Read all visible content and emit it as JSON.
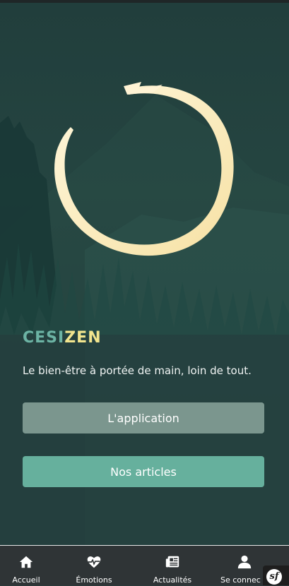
{
  "brand": {
    "part1": "CESI",
    "part2": "ZEN"
  },
  "hero": {
    "tagline": "Le bien-être à portée de main, loin de tout."
  },
  "buttons": {
    "app_label": "L'application",
    "articles_label": "Nos articles"
  },
  "bottom_nav": {
    "items": [
      {
        "label": "Accueil",
        "icon": "home-icon"
      },
      {
        "label": "Émotions",
        "icon": "heartbeat-icon"
      },
      {
        "label": "Actualités",
        "icon": "newspaper-icon"
      },
      {
        "label": "Se connec",
        "icon": "user-icon"
      }
    ]
  },
  "debug_badge": {
    "text": "sf"
  },
  "colors": {
    "brand_teal": "#6cb3a4",
    "brand_yellow": "#f2e58e",
    "button_app": "#7b968e",
    "button_articles": "#66b09d",
    "nav_background": "#2f3436"
  }
}
